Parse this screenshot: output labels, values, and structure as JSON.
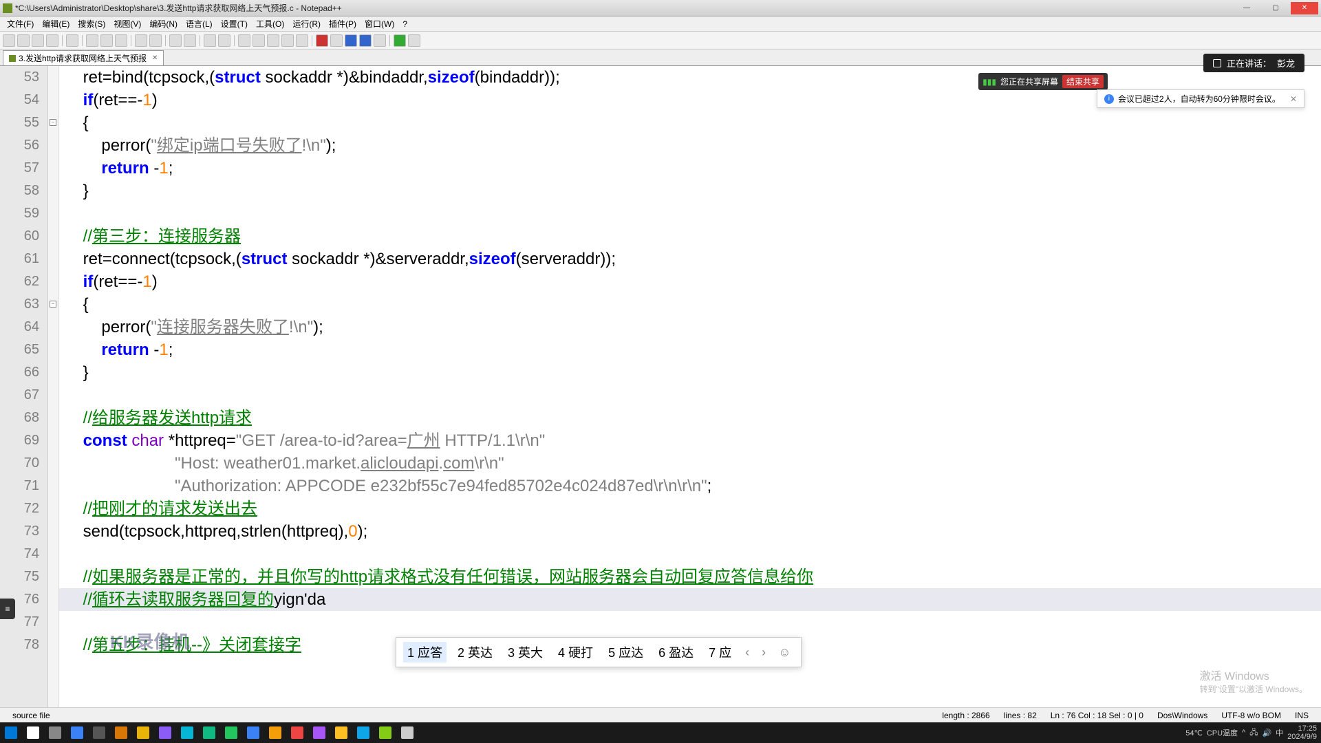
{
  "window": {
    "title": "*C:\\Users\\Administrator\\Desktop\\share\\3.发送http请求获取网络上天气预报.c - Notepad++"
  },
  "menu": [
    "文件(F)",
    "编辑(E)",
    "搜索(S)",
    "视图(V)",
    "编码(N)",
    "语言(L)",
    "设置(T)",
    "工具(O)",
    "运行(R)",
    "插件(P)",
    "窗口(W)",
    "?"
  ],
  "tab": {
    "name": "3.发送http请求获取网络上天气预报"
  },
  "meeting": {
    "speaking_label": "正在讲话：",
    "speaker": "彭龙",
    "share_text": "您正在共享屏幕",
    "end_share": "结束共享",
    "notice": "会议已超过2人，自动转为60分钟限时会议。"
  },
  "code_lines": [
    {
      "n": 53,
      "html": "    <span class='id'>ret</span><span class='op'>=</span><span class='id'>bind</span><span class='op'>(</span><span class='id'>tcpsock</span><span class='op'>,(</span><span class='kw'>struct</span> <span class='id'>sockaddr</span> <span class='op'>*)&amp;</span><span class='id'>bindaddr</span><span class='op'>,</span><span class='kw'>sizeof</span><span class='op'>(</span><span class='id'>bindaddr</span><span class='op'>));</span>"
    },
    {
      "n": 54,
      "html": "    <span class='kw'>if</span><span class='op'>(</span><span class='id'>ret</span><span class='op'>==-</span><span class='num'>1</span><span class='op'>)</span>"
    },
    {
      "n": 55,
      "html": "    <span class='op'>{</span>"
    },
    {
      "n": 56,
      "html": "        <span class='id'>perror</span><span class='op'>(</span><span class='str'>\"</span><span class='stru'>绑定ip端口号失败了</span><span class='str'>!\\n\"</span><span class='op'>);</span>"
    },
    {
      "n": 57,
      "html": "        <span class='kw'>return</span> <span class='op'>-</span><span class='num'>1</span><span class='op'>;</span>"
    },
    {
      "n": 58,
      "html": "    <span class='op'>}</span>"
    },
    {
      "n": 59,
      "html": ""
    },
    {
      "n": 60,
      "html": "    <span class='cmt'>//</span><span class='cmtu'>第三步：连接服务器</span>"
    },
    {
      "n": 61,
      "html": "    <span class='id'>ret</span><span class='op'>=</span><span class='id'>connect</span><span class='op'>(</span><span class='id'>tcpsock</span><span class='op'>,(</span><span class='kw'>struct</span> <span class='id'>sockaddr</span> <span class='op'>*)&amp;</span><span class='id'>serveraddr</span><span class='op'>,</span><span class='kw'>sizeof</span><span class='op'>(</span><span class='id'>serveraddr</span><span class='op'>));</span>"
    },
    {
      "n": 62,
      "html": "    <span class='kw'>if</span><span class='op'>(</span><span class='id'>ret</span><span class='op'>==-</span><span class='num'>1</span><span class='op'>)</span>"
    },
    {
      "n": 63,
      "html": "    <span class='op'>{</span>"
    },
    {
      "n": 64,
      "html": "        <span class='id'>perror</span><span class='op'>(</span><span class='str'>\"</span><span class='stru'>连接服务器失败了</span><span class='str'>!\\n\"</span><span class='op'>);</span>"
    },
    {
      "n": 65,
      "html": "        <span class='kw'>return</span> <span class='op'>-</span><span class='num'>1</span><span class='op'>;</span>"
    },
    {
      "n": 66,
      "html": "    <span class='op'>}</span>"
    },
    {
      "n": 67,
      "html": ""
    },
    {
      "n": 68,
      "html": "    <span class='cmt'>//</span><span class='cmtu'>给服务器发送http请求</span>"
    },
    {
      "n": 69,
      "html": "    <span class='kw'>const</span> <span class='ty'>char</span> <span class='op'>*</span><span class='id'>httpreq</span><span class='op'>=</span><span class='str'>\"GET /area-to-id?area=</span><span class='stru'>广州</span><span class='str'> HTTP/1.1\\r\\n\"</span>"
    },
    {
      "n": 70,
      "html": "                        <span class='str'>\"Host: weather01.market.</span><span class='stru'>alicloudapi</span><span class='str'>.</span><span class='stru'>com</span><span class='str'>\\r\\n\"</span>"
    },
    {
      "n": 71,
      "html": "                        <span class='str'>\"Authorization: APPCODE e232bf55c7e94fed85702e4c024d87ed\\r\\n\\r\\n\"</span><span class='op'>;</span>"
    },
    {
      "n": 72,
      "html": "    <span class='cmt'>//</span><span class='cmtu'>把刚才的请求发送出去</span>"
    },
    {
      "n": 73,
      "html": "    <span class='id'>send</span><span class='op'>(</span><span class='id'>tcpsock</span><span class='op'>,</span><span class='id'>httpreq</span><span class='op'>,</span><span class='id'>strlen</span><span class='op'>(</span><span class='id'>httpreq</span><span class='op'>),</span><span class='num'>0</span><span class='op'>);</span>"
    },
    {
      "n": 74,
      "html": ""
    },
    {
      "n": 75,
      "html": "    <span class='cmt'>//</span><span class='cmtu'>如果服务器是正常的，并且你写的http请求格式没有任何错误，网站服务器会自动回复应答信息给你</span>"
    },
    {
      "n": 76,
      "html": "    <span class='cmt'>//</span><span class='cmtu'>循环去读取服务器回复的</span><span class='id'>yign'da</span>",
      "hl": true
    },
    {
      "n": 77,
      "html": ""
    },
    {
      "n": 78,
      "html": "    <span class='cmt'>//</span><span class='cmtu'>第五步：挂机--》关闭套接字</span>"
    }
  ],
  "ime": {
    "candidates": [
      "1 应答",
      "2 英达",
      "3 英大",
      "4 硬打",
      "5 应达",
      "6 盈达",
      "7 应"
    ]
  },
  "watermark": "KK录像机",
  "status": {
    "left": "source file",
    "length": "length : 2866",
    "lines": "lines : 82",
    "pos": "Ln : 76    Col : 18    Sel : 0 | 0",
    "eol": "Dos\\Windows",
    "enc": "UTF-8 w/o BOM",
    "ins": "INS"
  },
  "activate": {
    "t1": "激活 Windows",
    "t2": "转到\"设置\"以激活 Windows。"
  },
  "tray": {
    "temp": "54℃",
    "cpu": "CPU温度",
    "time": "17:25",
    "date": "2024/9/9"
  }
}
